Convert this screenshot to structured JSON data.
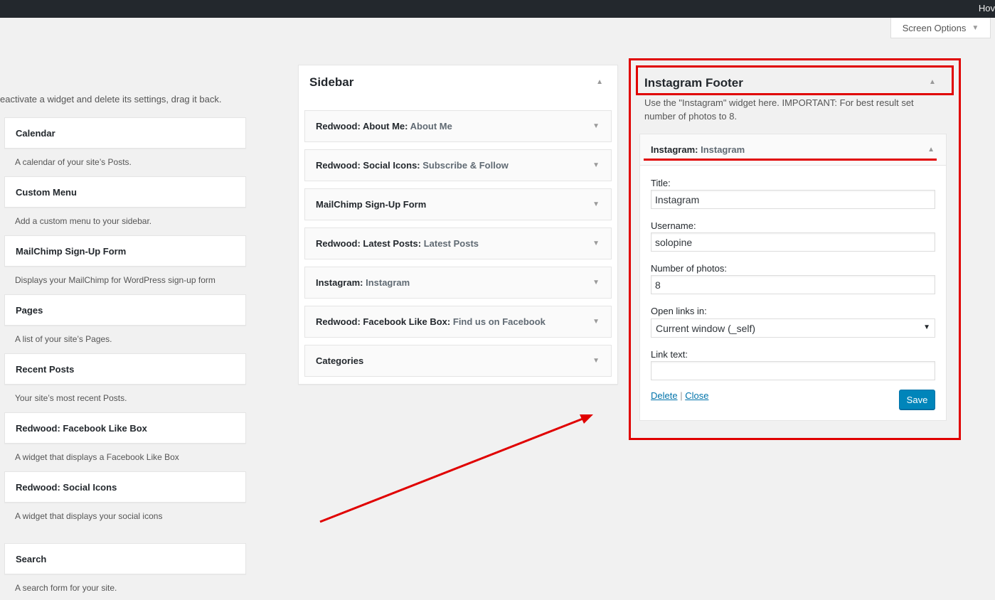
{
  "admin_bar": {
    "howdy": "Hov"
  },
  "screen_options": {
    "label": "Screen Options"
  },
  "available_widgets": {
    "hint": "eactivate a widget and delete its settings, drag it back.",
    "items": [
      {
        "title": "Calendar",
        "description": "A calendar of your site’s Posts."
      },
      {
        "title": "Custom Menu",
        "description": "Add a custom menu to your sidebar."
      },
      {
        "title": "MailChimp Sign-Up Form",
        "description": "Displays your MailChimp for WordPress sign-up form"
      },
      {
        "title": "Pages",
        "description": "A list of your site’s Pages."
      },
      {
        "title": "Recent Posts",
        "description": "Your site’s most recent Posts."
      },
      {
        "title": "Redwood: Facebook Like Box",
        "description": "A widget that displays a Facebook Like Box"
      },
      {
        "title": "Redwood: Social Icons",
        "description": "A widget that displays your social icons"
      },
      {
        "title": "Search",
        "description": "A search form for your site."
      }
    ]
  },
  "sidebar": {
    "title": "Sidebar",
    "widgets": [
      {
        "name": "Redwood: About Me:",
        "subtitle": "About Me"
      },
      {
        "name": "Redwood: Social Icons:",
        "subtitle": "Subscribe & Follow"
      },
      {
        "name": "MailChimp Sign-Up Form",
        "subtitle": ""
      },
      {
        "name": "Redwood: Latest Posts:",
        "subtitle": "Latest Posts"
      },
      {
        "name": "Instagram:",
        "subtitle": "Instagram"
      },
      {
        "name": "Redwood: Facebook Like Box:",
        "subtitle": "Find us on Facebook"
      },
      {
        "name": "Categories",
        "subtitle": ""
      }
    ]
  },
  "instagram_footer": {
    "title": "Instagram Footer",
    "description": "Use the \"Instagram\" widget here. IMPORTANT: For best result set number of photos to 8.",
    "widget": {
      "name": "Instagram:",
      "subtitle": "Instagram",
      "title_label": "Title:",
      "title_value": "Instagram",
      "username_label": "Username:",
      "username_value": "solopine",
      "photos_label": "Number of photos:",
      "photos_value": "8",
      "open_links_label": "Open links in:",
      "open_links_value": "Current window (_self)",
      "link_text_label": "Link text:",
      "link_text_value": "",
      "delete_label": "Delete",
      "separator": "|",
      "close_label": "Close",
      "save_label": "Save"
    }
  },
  "colors": {
    "highlight": "#e00000",
    "primary_button": "#0085ba",
    "link": "#0073aa"
  }
}
